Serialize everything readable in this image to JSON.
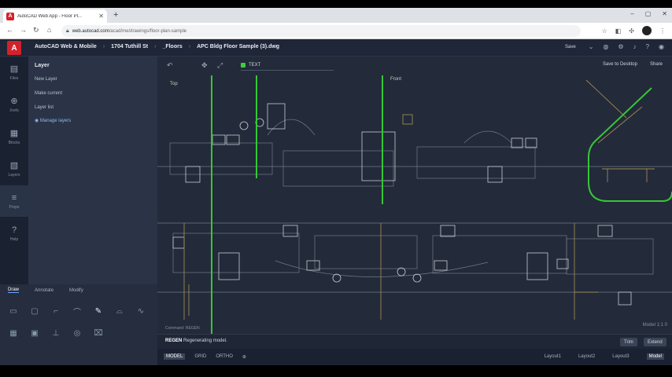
{
  "browser": {
    "tab_title": "AutoCAD Web App - Floor Pl...",
    "tab_favicon": "A",
    "new_tab": "+",
    "url_host": "web.autocad.com",
    "url_path": "/acad/me/drawings/floor-plan-sample",
    "window_controls": [
      "–",
      "▢",
      "✕"
    ]
  },
  "app": {
    "logo": "A",
    "breadcrumbs": [
      "AutoCAD Web & Mobile",
      "1704 Tuthill St",
      "_Floors",
      "APC Bldg Floor Sample (3).dwg"
    ],
    "save_label": "Save"
  },
  "rail": [
    {
      "label": "Files",
      "icon": "▤"
    },
    {
      "label": "Xrefs",
      "icon": "⊕"
    },
    {
      "label": "Blocks",
      "icon": "▦"
    },
    {
      "label": "Layers",
      "icon": "▧"
    },
    {
      "label": "Props",
      "icon": "≡"
    },
    {
      "label": "Help",
      "icon": "?"
    }
  ],
  "panel": {
    "title": "Layer",
    "items": [
      "New Layer",
      "Make current",
      "Layer list"
    ],
    "link": "Manage layers"
  },
  "tools": {
    "tabs": [
      "Draw",
      "Annotate",
      "Modify"
    ],
    "active_tab": "Draw"
  },
  "canvas": {
    "layer_name": "TEXT",
    "share_label": "Share",
    "save_to_label": "Save to Desktop",
    "view_labels": [
      "Top",
      "Front"
    ],
    "coord_readout": "Model   1:1   0"
  },
  "command": {
    "hint": "Command: REGEN",
    "prompt_label": "REGEN",
    "prompt_text": "Regenerating model.",
    "buttons": [
      "Trim",
      "Extend"
    ]
  },
  "status": {
    "left": [
      "MODEL",
      "GRID",
      "ORTHO",
      "⊕"
    ],
    "left_active": "MODEL",
    "right": [
      "Layout1",
      "Layout2",
      "Layout3",
      "Model"
    ],
    "right_active": "Model"
  }
}
